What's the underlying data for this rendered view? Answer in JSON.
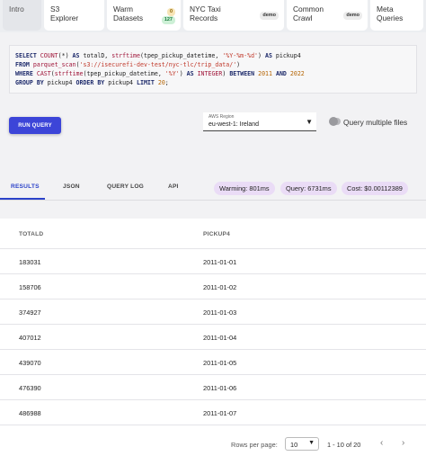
{
  "top_tabs": [
    {
      "line1": "Intro",
      "line2": ""
    },
    {
      "line1": "S3",
      "line2": "Explorer"
    },
    {
      "line1": "Warm",
      "line2": "Datasets",
      "badge_top": "0",
      "badge_bottom": "127"
    },
    {
      "line1": "NYC Taxi",
      "line2": "Records",
      "badge": "demo"
    },
    {
      "line1": "Common",
      "line2": "Crawl",
      "badge": "demo"
    },
    {
      "line1": "Meta",
      "line2": "Queries"
    }
  ],
  "query": {
    "line1": [
      "SELECT ",
      "COUNT",
      "(*) ",
      "AS",
      " totalD, ",
      "strftime",
      "(tpep_pickup_datetime, ",
      "'%Y-%m-%d'",
      ") ",
      "AS",
      " pickup4"
    ],
    "line2": [
      "FROM",
      " ",
      "parquet_scan",
      "(",
      "'s3://isecurefi-dev-test/nyc-tlc/trip_data/'",
      ")"
    ],
    "line3": [
      "WHERE",
      " ",
      "CAST",
      "(",
      "strftime",
      "(tpep_pickup_datetime, ",
      "'%Y'",
      ") ",
      "AS",
      " ",
      "INTEGER",
      ") ",
      "BETWEEN",
      " ",
      "2011",
      " ",
      "AND",
      " ",
      "2022"
    ],
    "line4": [
      "GROUP BY",
      " pickup4 ",
      "ORDER BY",
      " pickup4 ",
      "LIMIT",
      " ",
      "20",
      ";"
    ]
  },
  "controls": {
    "run_label": "RUN QUERY",
    "region_label": "AWS Region",
    "region_value": "eu-west-1: Ireland",
    "multi_label": "Query multiple files"
  },
  "result_tabs": [
    "RESULTS",
    "JSON",
    "QUERY LOG",
    "API"
  ],
  "stats": {
    "warming": "Warming: 801ms",
    "query": "Query: 6731ms",
    "cost": "Cost: $0.00112389"
  },
  "table": {
    "columns": [
      "TOTALD",
      "PICKUP4"
    ],
    "rows": [
      [
        "183031",
        "2011-01-01"
      ],
      [
        "158706",
        "2011-01-02"
      ],
      [
        "374927",
        "2011-01-03"
      ],
      [
        "407012",
        "2011-01-04"
      ],
      [
        "439070",
        "2011-01-05"
      ],
      [
        "476390",
        "2011-01-06"
      ],
      [
        "486988",
        "2011-01-07"
      ]
    ]
  },
  "pager": {
    "rows_label": "Rows per page:",
    "rows_value": "10",
    "range": "1 - 10 of 20"
  },
  "colors": {
    "accent": "#3c45d8",
    "active_tab": "#2c43c9",
    "pill": "#eadcf6"
  }
}
